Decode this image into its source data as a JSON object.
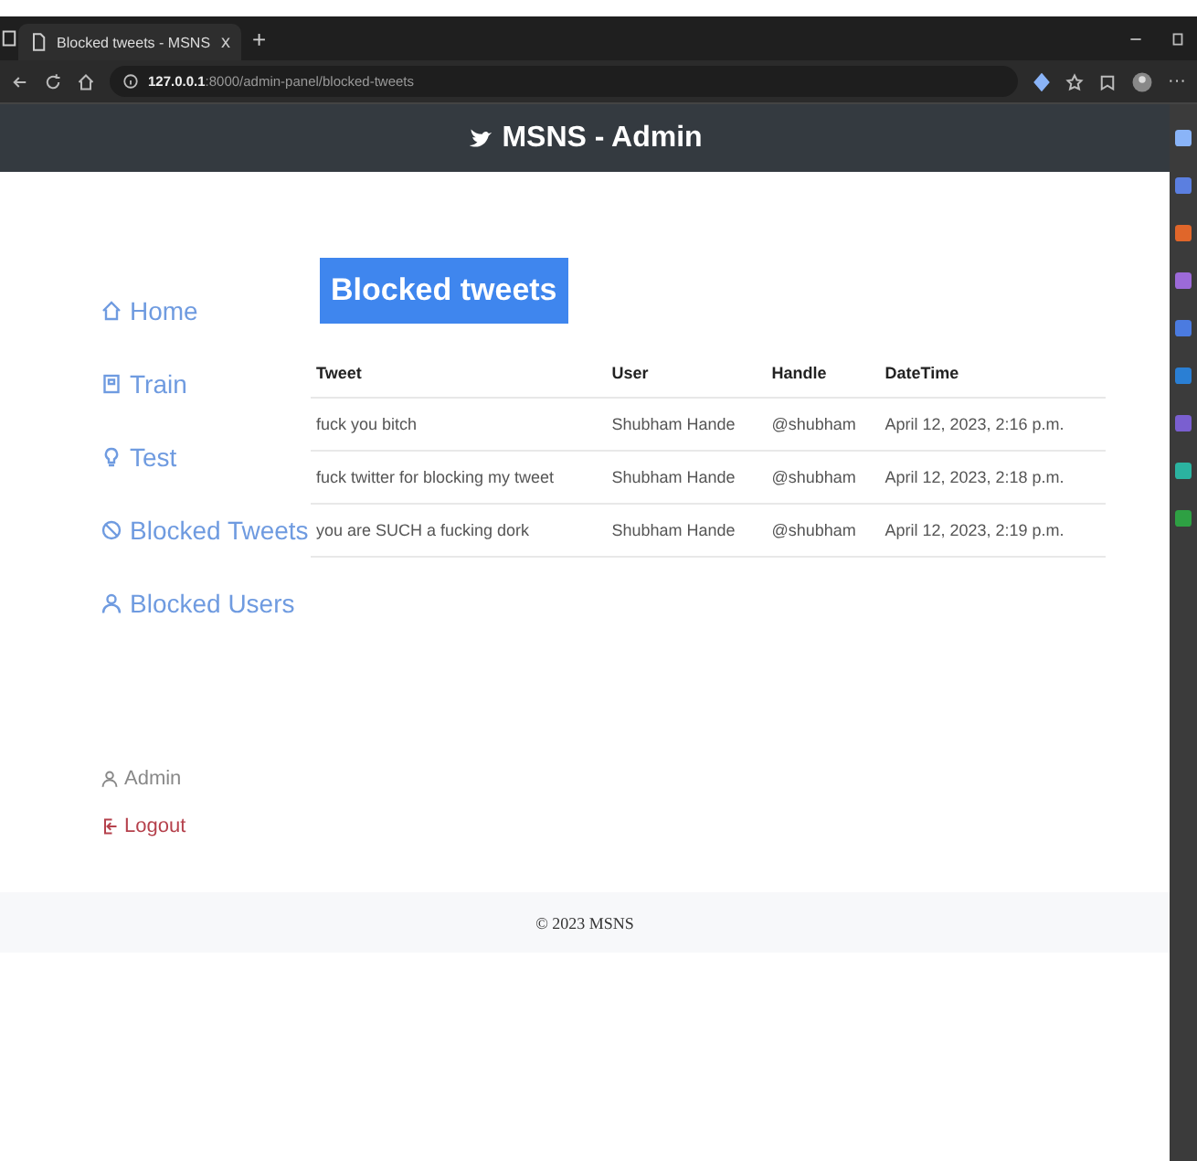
{
  "browser": {
    "tab_title": "Blocked tweets - MSNS",
    "close": "x",
    "new_tab": "+",
    "url_host": "127.0.0.1",
    "url_path": ":8000/admin-panel/blocked-tweets",
    "more": "···"
  },
  "header": {
    "title": "MSNS - Admin"
  },
  "sidebar": {
    "items": [
      {
        "kind": "home",
        "label": "Home"
      },
      {
        "kind": "train",
        "label": "Train"
      },
      {
        "kind": "test",
        "label": "Test"
      },
      {
        "kind": "blocked-tweets",
        "label": "Blocked Tweets"
      },
      {
        "kind": "blocked-users",
        "label": "Blocked Users"
      }
    ],
    "account": {
      "user": "Admin",
      "logout": "Logout"
    }
  },
  "content": {
    "title": "Blocked tweets",
    "table": {
      "columns": [
        "Tweet",
        "User",
        "Handle",
        "DateTime"
      ],
      "rows": [
        [
          "fuck you bitch",
          "Shubham Hande",
          "@shubham",
          "April 12, 2023, 2:16 p.m."
        ],
        [
          "fuck twitter for blocking my tweet",
          "Shubham Hande",
          "@shubham",
          "April 12, 2023, 2:18 p.m."
        ],
        [
          "you are SUCH a fucking dork",
          "Shubham Hande",
          "@shubham",
          "April 12, 2023, 2:19 p.m."
        ]
      ]
    }
  },
  "footer": {
    "text": "© 2023 MSNS"
  }
}
